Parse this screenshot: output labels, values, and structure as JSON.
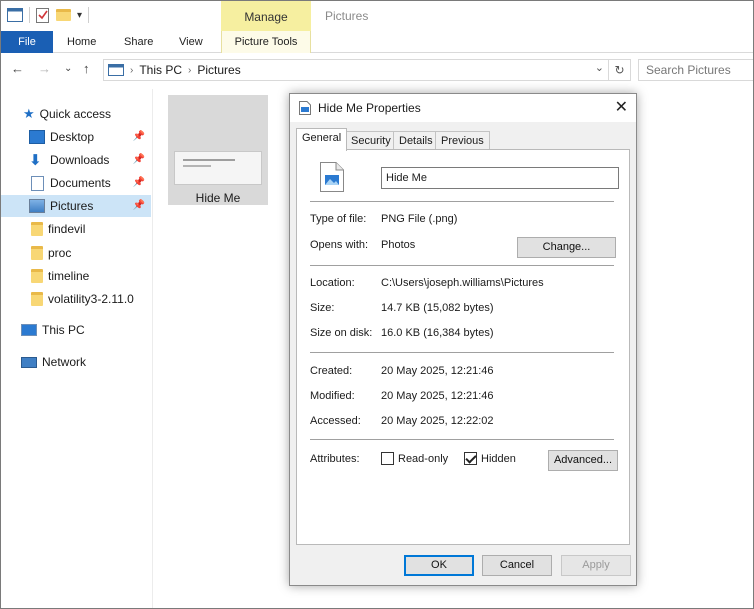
{
  "window": {
    "title": "Pictures",
    "contextual_tab_group": "Manage",
    "ribbon_tabs": [
      "File",
      "Home",
      "Share",
      "View",
      "Picture Tools"
    ]
  },
  "address": {
    "path": [
      "This PC",
      "Pictures"
    ],
    "search_placeholder": "Search Pictures"
  },
  "navpane": {
    "quick_access": "Quick access",
    "items": [
      {
        "label": "Desktop",
        "pinned": true
      },
      {
        "label": "Downloads",
        "pinned": true
      },
      {
        "label": "Documents",
        "pinned": true
      },
      {
        "label": "Pictures",
        "pinned": true,
        "selected": true
      },
      {
        "label": "findevil"
      },
      {
        "label": "proc"
      },
      {
        "label": "timeline"
      },
      {
        "label": "volatility3-2.11.0"
      }
    ],
    "this_pc": "This PC",
    "network": "Network"
  },
  "content": {
    "file_label": "Hide Me"
  },
  "dialog": {
    "title": "Hide Me Properties",
    "tabs": [
      "General",
      "Security",
      "Details",
      "Previous Versions"
    ],
    "active_tab": "General",
    "name": "Hide Me",
    "type_label": "Type of file:",
    "type_value": "PNG File (.png)",
    "opens_label": "Opens with:",
    "opens_value": "Photos",
    "change_button": "Change...",
    "location_label": "Location:",
    "location_value": "C:\\Users\\joseph.williams\\Pictures",
    "size_label": "Size:",
    "size_value": "14.7 KB (15,082 bytes)",
    "size_disk_label": "Size on disk:",
    "size_disk_value": "16.0 KB (16,384 bytes)",
    "created_label": "Created:",
    "created_value": "20 May 2025, 12:21:46",
    "modified_label": "Modified:",
    "modified_value": "20 May 2025, 12:21:46",
    "accessed_label": "Accessed:",
    "accessed_value": "20 May 2025, 12:22:02",
    "attributes_label": "Attributes:",
    "readonly_label": "Read-only",
    "readonly_checked": false,
    "hidden_label": "Hidden",
    "hidden_checked": true,
    "advanced_button": "Advanced...",
    "ok_button": "OK",
    "cancel_button": "Cancel",
    "apply_button": "Apply"
  },
  "colors": {
    "accent": "#1a5fb4",
    "manage_tab": "#f6efa0",
    "selection": "#cce4f7",
    "default_button_border": "#0078d7"
  }
}
